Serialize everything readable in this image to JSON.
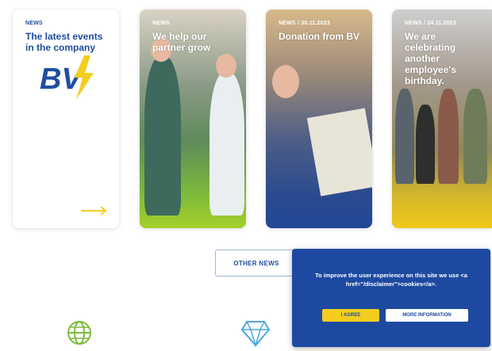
{
  "cards": [
    {
      "tag": "NEWS",
      "title": "The latest events in the company"
    },
    {
      "tag": "NEWS",
      "title": "We help our partner grow"
    },
    {
      "tag": "NEWS / 30.11.2023",
      "title": "Donation from BV"
    },
    {
      "tag": "NEWS / 24.11.2023",
      "title": "We are celebrating another employee's birthday."
    }
  ],
  "other_news_label": "OTHER NEWS",
  "cookie": {
    "text": "To improve the user experience on this site we use <a href=\"/disclaimer\">cookies</a>.",
    "agree_label": "I AGREE",
    "more_label": "MORE INFORMATION"
  },
  "colors": {
    "brand_blue": "#1f4ea0",
    "brand_yellow": "#f4cd1e",
    "green": "#7dbb3a"
  },
  "icons": [
    "bv-logo",
    "arrow-right-icon",
    "globe-icon",
    "diamond-icon"
  ]
}
